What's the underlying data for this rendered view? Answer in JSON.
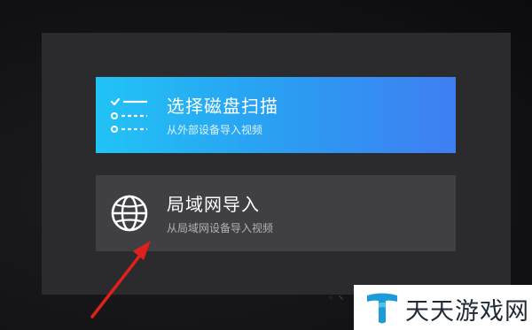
{
  "dialog": {
    "options": [
      {
        "title": "选择磁盘扫描",
        "subtitle": "从外部设备导入视频",
        "icon": "disk-scan-list-icon"
      },
      {
        "title": "局域网导入",
        "subtitle": "从局域网设备导入视频",
        "icon": "globe-icon"
      }
    ]
  },
  "watermark": {
    "text": "天天游戏网",
    "logo_icon": "letter-t-logo-icon"
  },
  "colors": {
    "dialog_bg": "#2b2b2e",
    "primary_gradient_start": "#21c3f6",
    "primary_gradient_end": "#3f7ef2",
    "secondary_bg": "#3f3f44",
    "annotation_arrow": "#e0211b",
    "brand_blue": "#1b9cd9"
  }
}
